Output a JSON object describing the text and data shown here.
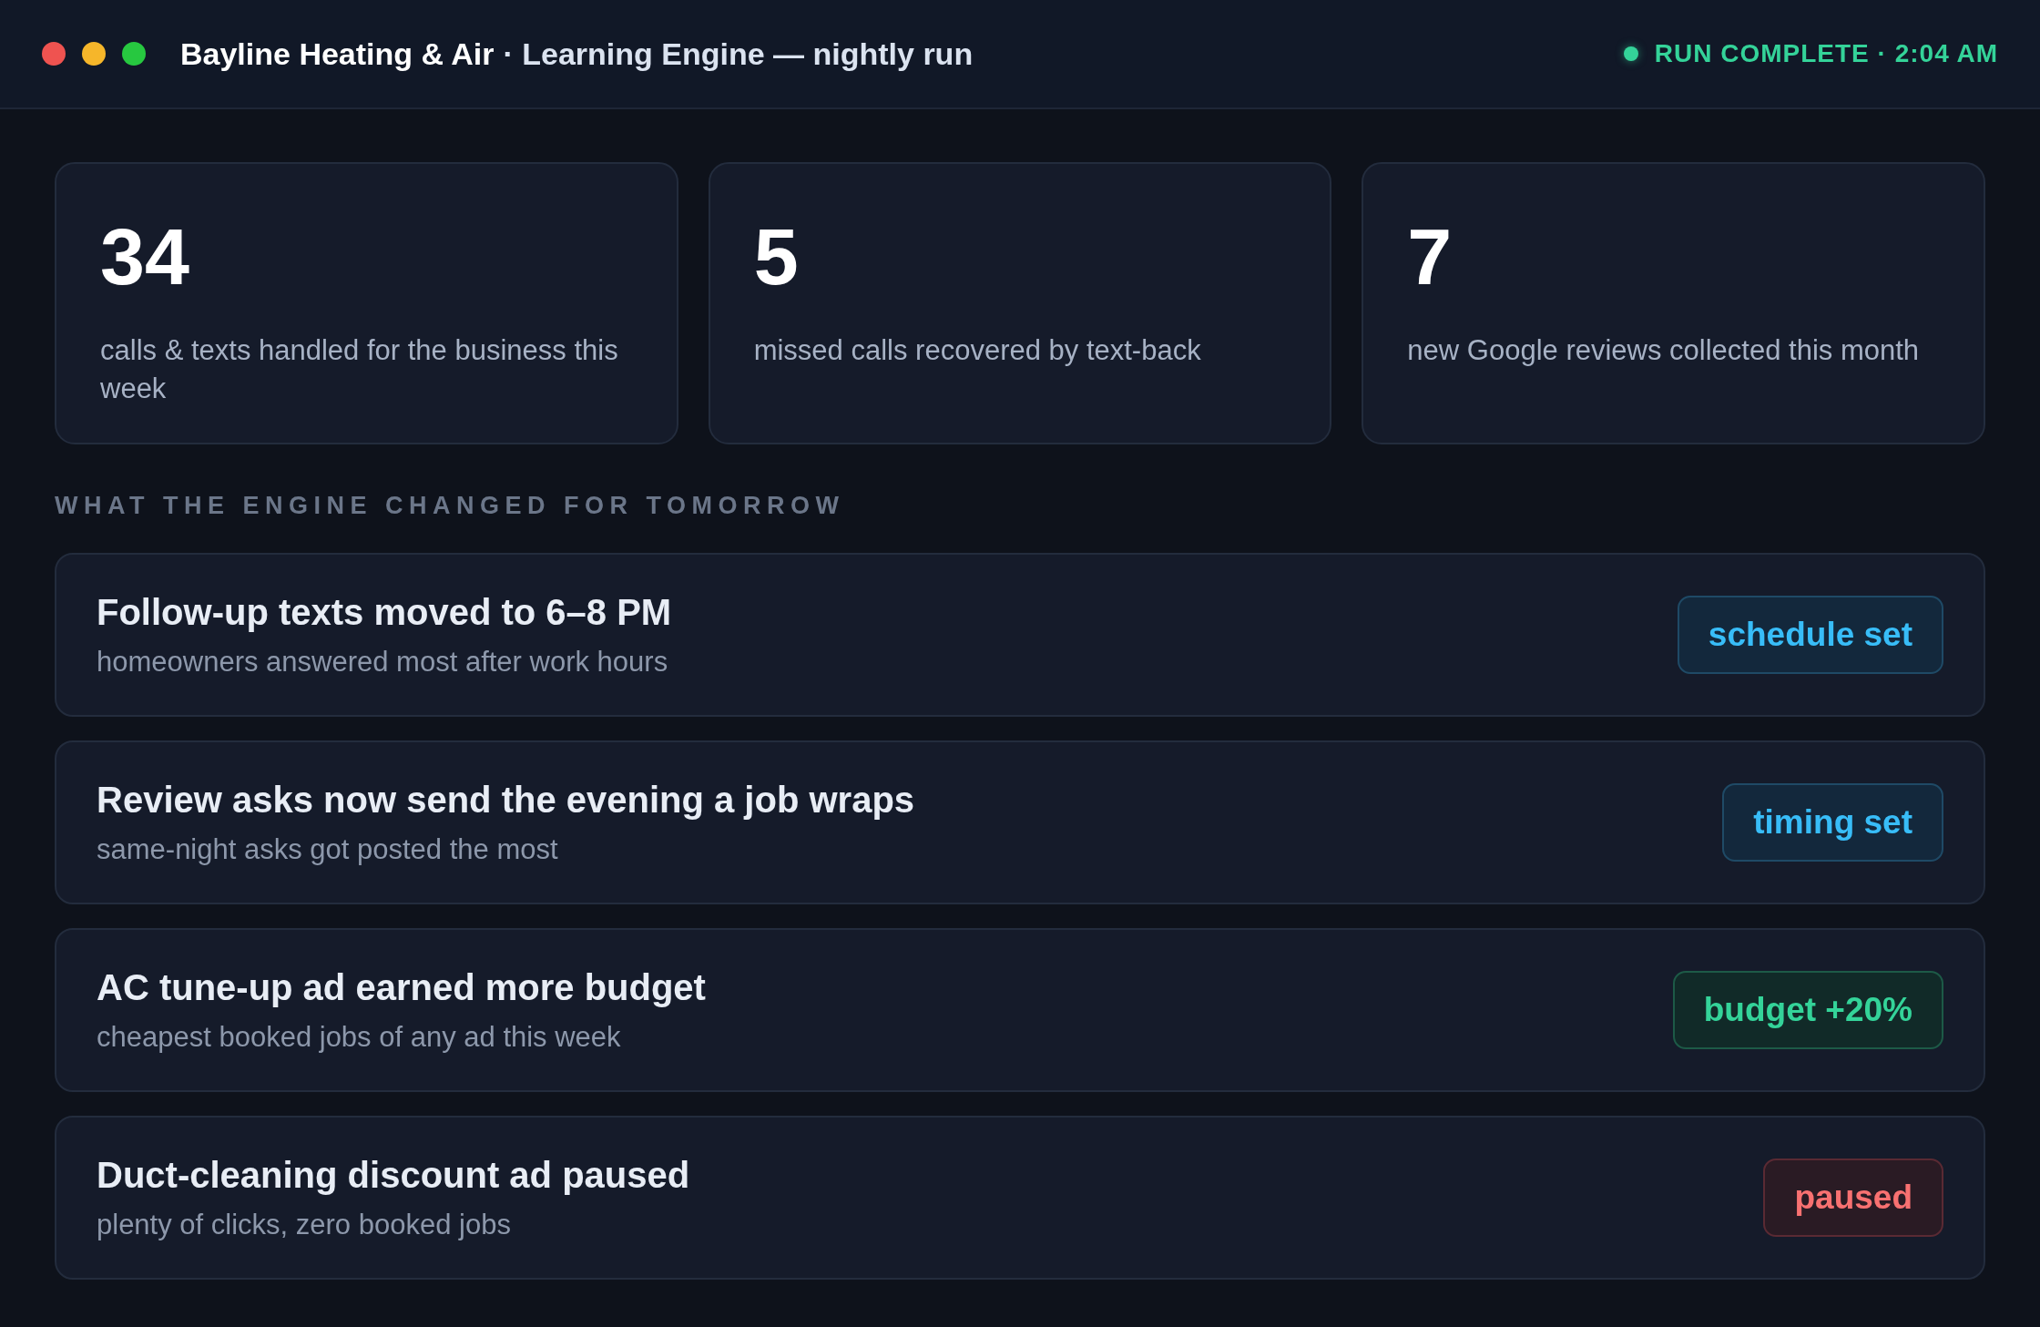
{
  "window": {
    "business": "Bayline Heating & Air",
    "title": "· Learning Engine — nightly run",
    "status": "RUN COMPLETE · 2:04 AM"
  },
  "stats": [
    {
      "value": "34",
      "label": "calls & texts handled for the business this week"
    },
    {
      "value": "5",
      "label": "missed calls recovered by text-back"
    },
    {
      "value": "7",
      "label": "new Google reviews collected this month"
    }
  ],
  "section_title": "WHAT THE ENGINE CHANGED FOR TOMORROW",
  "changes": [
    {
      "title": "Follow-up texts moved to 6–8 PM",
      "detail": "homeowners answered most after work hours",
      "tag": "schedule set",
      "kind": "info"
    },
    {
      "title": "Review asks now send the evening a job wraps",
      "detail": "same-night asks got posted the most",
      "tag": "timing set",
      "kind": "info"
    },
    {
      "title": "AC tune-up ad earned more budget",
      "detail": "cheapest booked jobs of any ad this week",
      "tag": "budget +20%",
      "kind": "success"
    },
    {
      "title": "Duct-cleaning discount ad paused",
      "detail": "plenty of clicks, zero booked jobs",
      "tag": "paused",
      "kind": "danger"
    }
  ]
}
